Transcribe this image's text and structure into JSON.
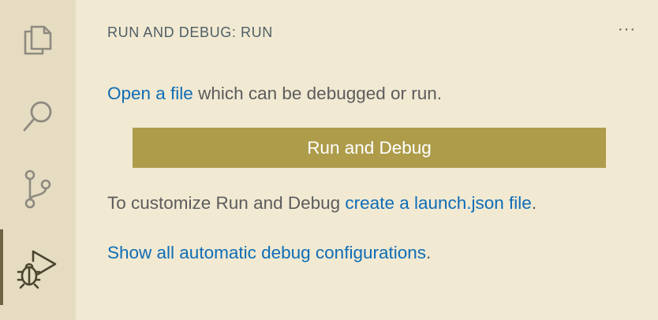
{
  "activity_bar": {
    "items": [
      {
        "icon": "files-icon",
        "active": false
      },
      {
        "icon": "search-icon",
        "active": false
      },
      {
        "icon": "source-control-icon",
        "active": false
      },
      {
        "icon": "run-debug-icon",
        "active": true
      }
    ]
  },
  "panel": {
    "title": "RUN AND DEBUG: RUN",
    "more_actions": "···",
    "open_file_link": "Open a file",
    "open_file_rest": " which can be debugged or run.",
    "run_button_label": "Run and Debug",
    "customize_text": "To customize Run and Debug ",
    "launch_json_link": "create a launch.json file",
    "customize_end": ".",
    "show_configs_link": "Show all automatic debug configurations",
    "show_configs_end": "."
  },
  "colors": {
    "background": "#f1e9d2",
    "activity_bar": "#e6dcc2",
    "button": "#ae9c4b",
    "link": "#0f6db6",
    "text": "#5c5c5c",
    "title": "#4f5f66"
  }
}
